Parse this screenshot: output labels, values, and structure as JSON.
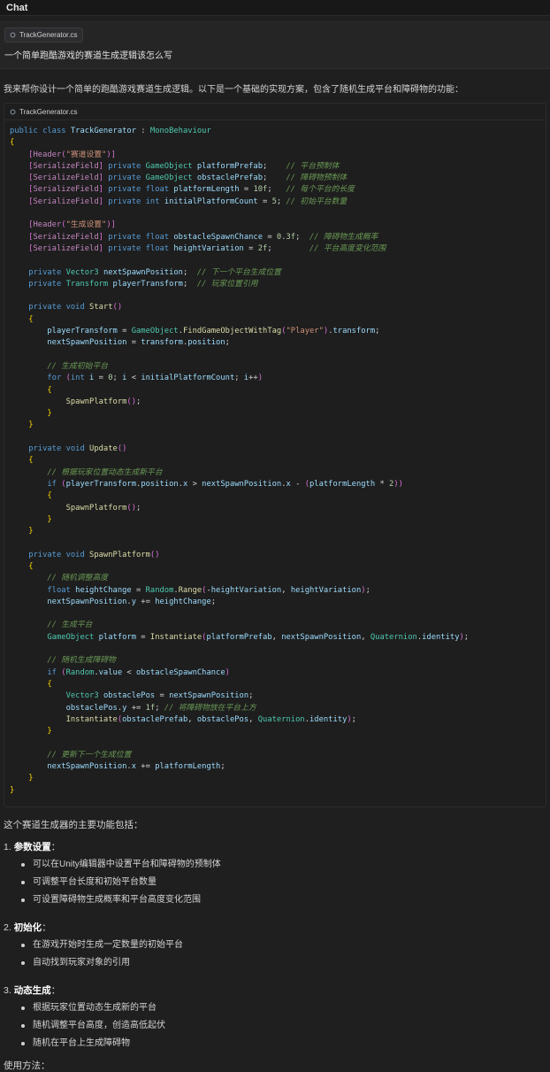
{
  "window": {
    "tab_label": "Chat"
  },
  "user_message": {
    "file_chip": "TrackGenerator.cs",
    "text": "一个简单跑酷游戏的赛道生成逻辑该怎么写"
  },
  "assistant": {
    "intro": "我来帮你设计一个简单的跑酷游戏赛道生成逻辑。以下是一个基础的实现方案，包含了随机生成平台和障碍物的功能：",
    "code_file": "TrackGenerator.cs",
    "code_lines": [
      "public class TrackGenerator : MonoBehaviour",
      "{",
      "    [Header(\"赛道设置\")]",
      "    [SerializeField] private GameObject platformPrefab;    // 平台预制体",
      "    [SerializeField] private GameObject obstaclePrefab;    // 障碍物预制体",
      "    [SerializeField] private float platformLength = 10f;   // 每个平台的长度",
      "    [SerializeField] private int initialPlatformCount = 5; // 初始平台数量",
      "",
      "    [Header(\"生成设置\")]",
      "    [SerializeField] private float obstacleSpawnChance = 0.3f;  // 障碍物生成概率",
      "    [SerializeField] private float heightVariation = 2f;        // 平台高度变化范围",
      "",
      "    private Vector3 nextSpawnPosition;  // 下一个平台生成位置",
      "    private Transform playerTransform;  // 玩家位置引用",
      "",
      "    private void Start()",
      "    {",
      "        playerTransform = GameObject.FindGameObjectWithTag(\"Player\").transform;",
      "        nextSpawnPosition = transform.position;",
      "",
      "        // 生成初始平台",
      "        for (int i = 0; i < initialPlatformCount; i++)",
      "        {",
      "            SpawnPlatform();",
      "        }",
      "    }",
      "",
      "    private void Update()",
      "    {",
      "        // 根据玩家位置动态生成新平台",
      "        if (playerTransform.position.x > nextSpawnPosition.x - (platformLength * 2))",
      "        {",
      "            SpawnPlatform();",
      "        }",
      "    }",
      "",
      "    private void SpawnPlatform()",
      "    {",
      "        // 随机调整高度",
      "        float heightChange = Random.Range(-heightVariation, heightVariation);",
      "        nextSpawnPosition.y += heightChange;",
      "",
      "        // 生成平台",
      "        GameObject platform = Instantiate(platformPrefab, nextSpawnPosition, Quaternion.identity);",
      "",
      "        // 随机生成障碍物",
      "        if (Random.value < obstacleSpawnChance)",
      "        {",
      "            Vector3 obstaclePos = nextSpawnPosition;",
      "            obstaclePos.y += 1f; // 将障碍物放在平台上方",
      "            Instantiate(obstaclePrefab, obstaclePos, Quaternion.identity);",
      "        }",
      "",
      "        // 更新下一个生成位置",
      "        nextSpawnPosition.x += platformLength;",
      "    }",
      "}"
    ],
    "summary": "这个赛道生成器的主要功能包括：",
    "sections": [
      {
        "title": "1. 参数设置",
        "items": [
          "可以在Unity编辑器中设置平台和障碍物的预制体",
          "可调整平台长度和初始平台数量",
          "可设置障碍物生成概率和平台高度变化范围"
        ]
      },
      {
        "title": "2. 初始化",
        "items": [
          "在游戏开始时生成一定数量的初始平台",
          "自动找到玩家对象的引用"
        ]
      },
      {
        "title": "3. 动态生成",
        "items": [
          "根据玩家位置动态生成新的平台",
          "随机调整平台高度，创造高低起伏",
          "随机在平台上生成障碍物"
        ]
      }
    ],
    "usage_label": "使用方法："
  }
}
